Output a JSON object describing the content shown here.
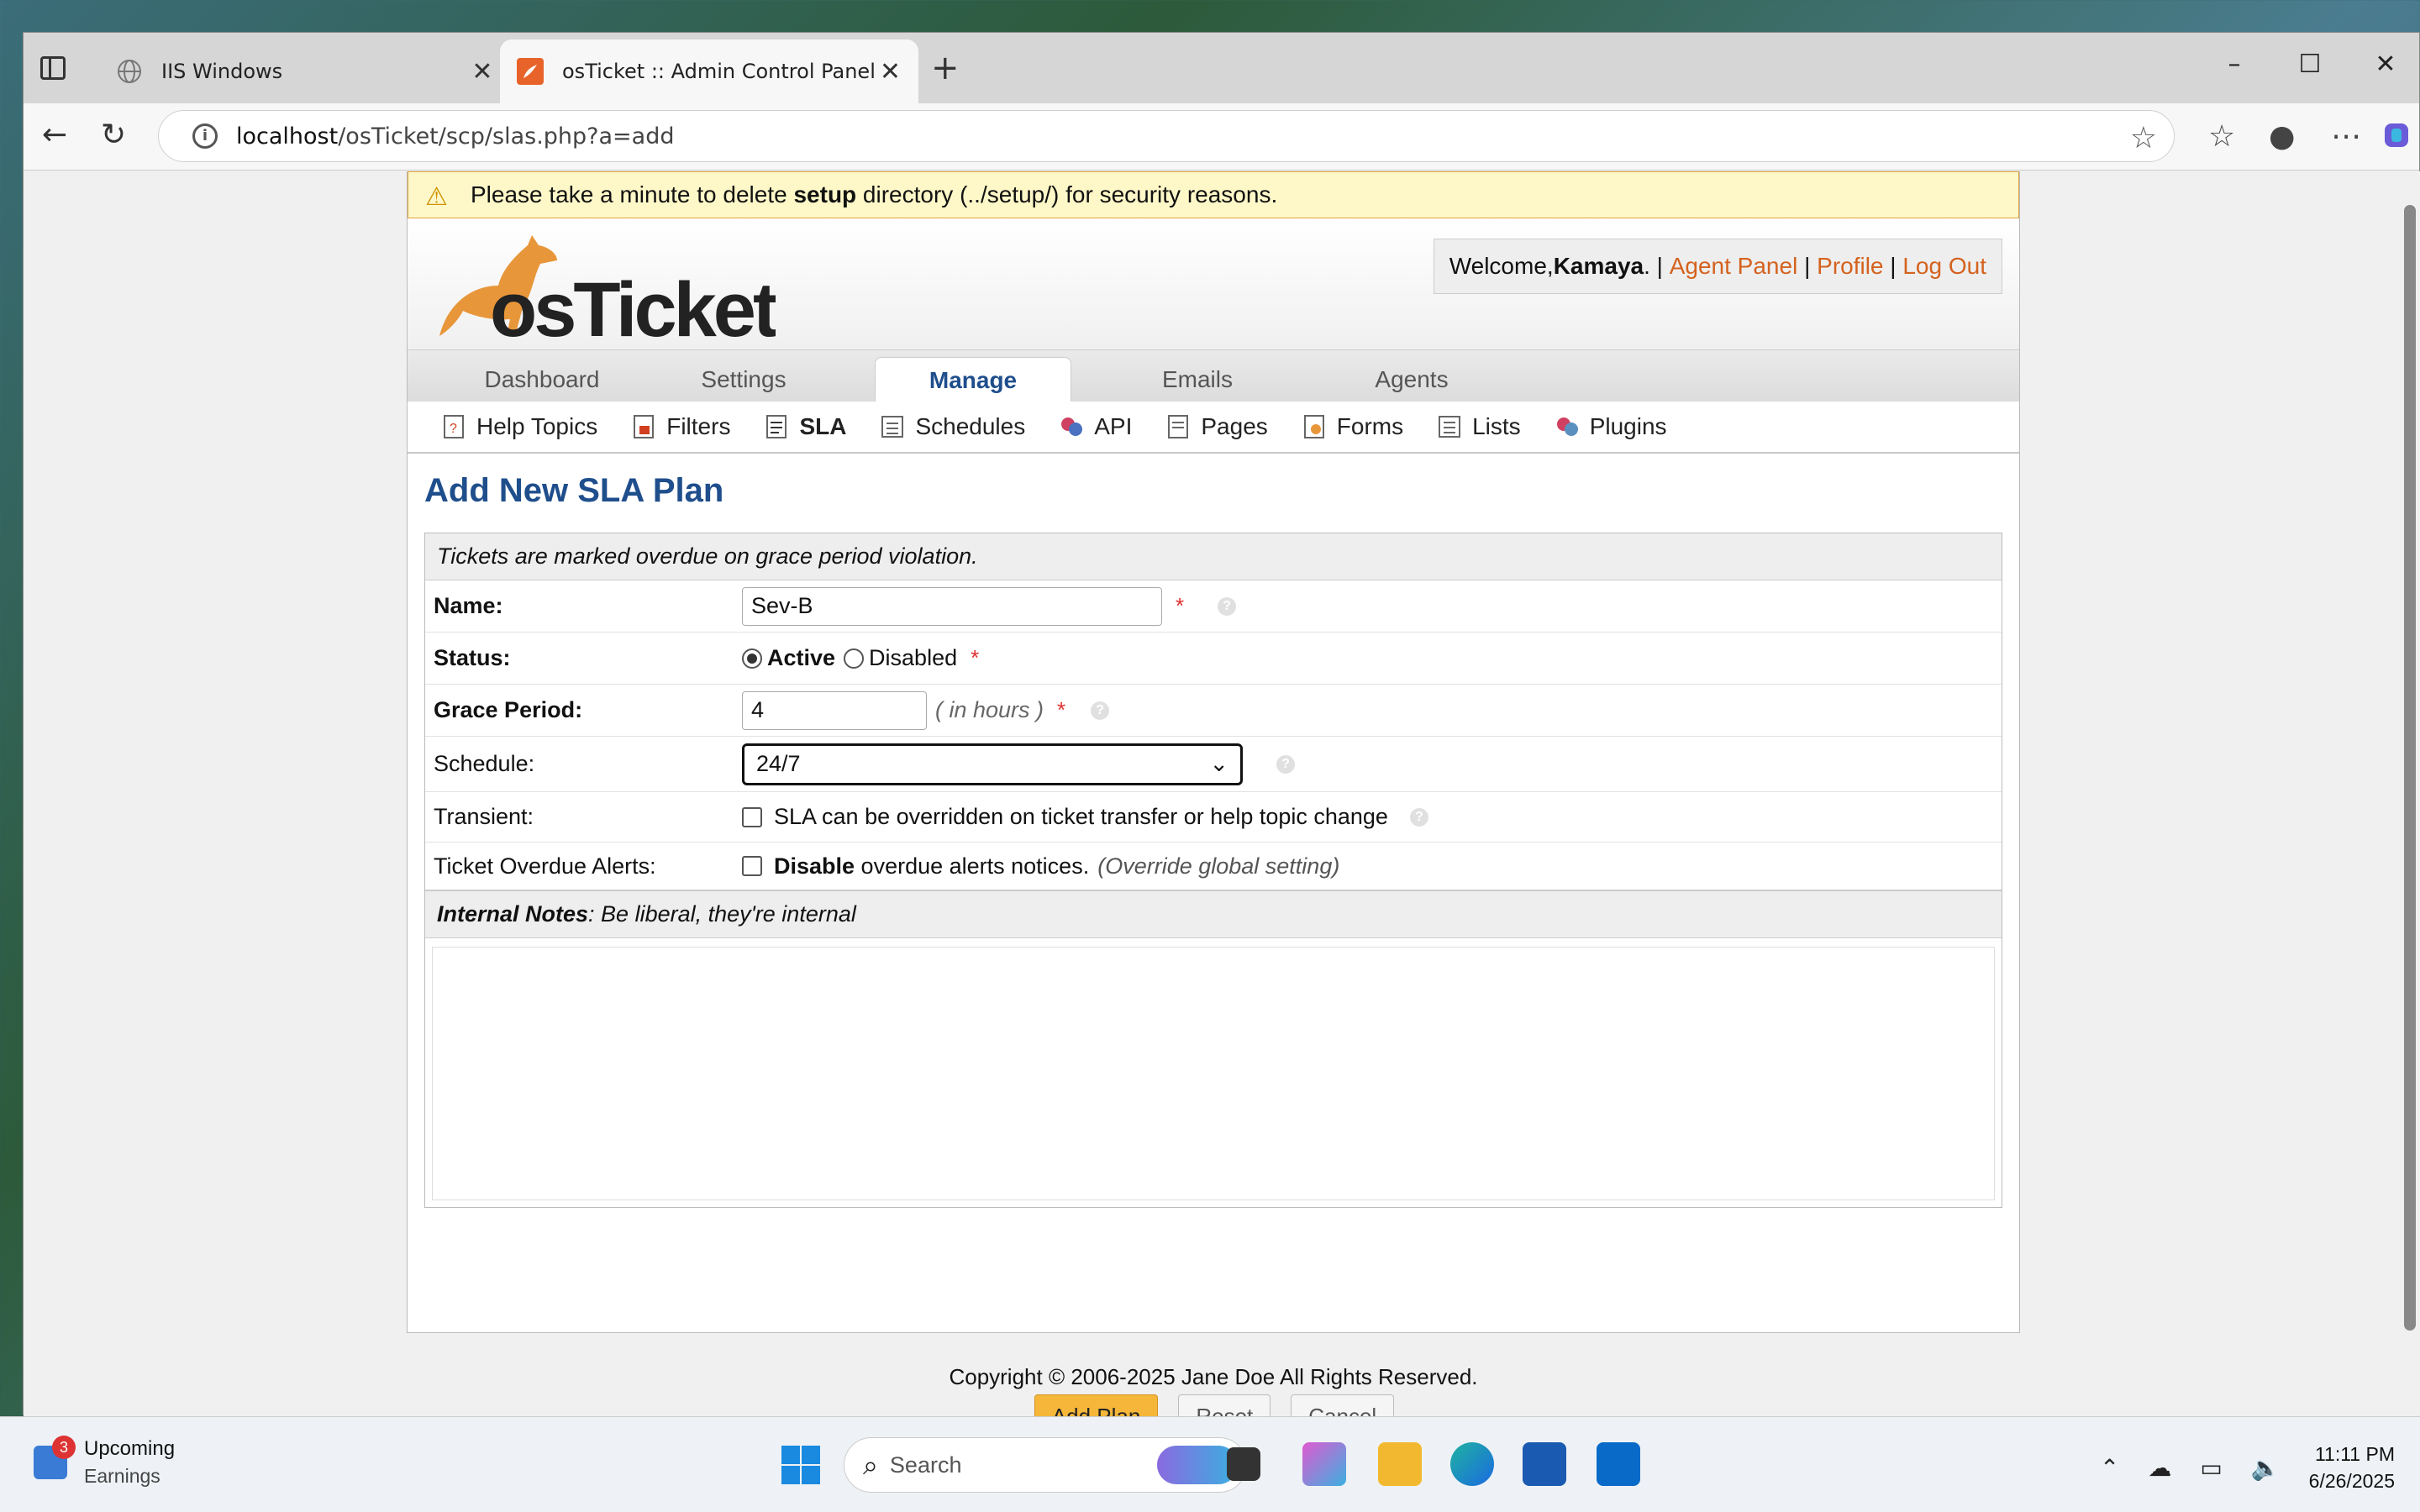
{
  "browser": {
    "tabs": [
      {
        "label": "IIS Windows",
        "close": "✕"
      },
      {
        "label": "osTicket :: Admin Control Panel",
        "close": "✕"
      }
    ],
    "url_host": "localhost",
    "url_path": "/osTicket/scp/slas.php?a=add"
  },
  "warning": {
    "prefix": "Please take a minute to delete ",
    "bold": "setup",
    "suffix": " directory (../setup/) for security reasons."
  },
  "header": {
    "welcome_prefix": "Welcome, ",
    "user": "Kamaya",
    "welcome_suffix": ". |",
    "agent_panel": "Agent Panel",
    "sep1": "|",
    "profile": "Profile",
    "sep2": "|",
    "logout": "Log Out"
  },
  "nav": {
    "tabs": [
      "Dashboard",
      "Settings",
      "Manage",
      "Emails",
      "Agents"
    ],
    "active": "Manage"
  },
  "subnav": [
    "Help Topics",
    "Filters",
    "SLA",
    "Schedules",
    "API",
    "Pages",
    "Forms",
    "Lists",
    "Plugins"
  ],
  "form": {
    "title": "Add New SLA Plan",
    "intro": "Tickets are marked overdue on grace period violation.",
    "name_label": "Name:",
    "name_value": "Sev-B",
    "required": "*",
    "status_label": "Status:",
    "status_active": "Active",
    "status_disabled": "Disabled",
    "grace_label": "Grace Period:",
    "grace_value": "4",
    "grace_unit": "( in hours )",
    "schedule_label": "Schedule:",
    "schedule_value": "24/7",
    "transient_label": "Transient:",
    "transient_text": "SLA can be overridden on ticket transfer or help topic change",
    "alerts_label": "Ticket Overdue Alerts:",
    "alerts_bold": "Disable",
    "alerts_text": " overdue alerts notices.",
    "alerts_note": "(Override global setting)",
    "notes_bold": "Internal Notes",
    "notes_text": ": Be liberal, they're internal"
  },
  "buttons": {
    "add": "Add Plan",
    "reset": "Reset",
    "cancel": "Cancel"
  },
  "footer": "Copyright © 2006-2025 Jane Doe All Rights Reserved.",
  "taskbar": {
    "weather_title": "Upcoming",
    "weather_sub": "Earnings",
    "badge": "3",
    "search": "Search",
    "time": "11:11 PM",
    "date": "6/26/2025"
  },
  "colors": {
    "accent": "#1f4e8c",
    "link": "#d4621e",
    "primary_button": "#f5b63a"
  }
}
